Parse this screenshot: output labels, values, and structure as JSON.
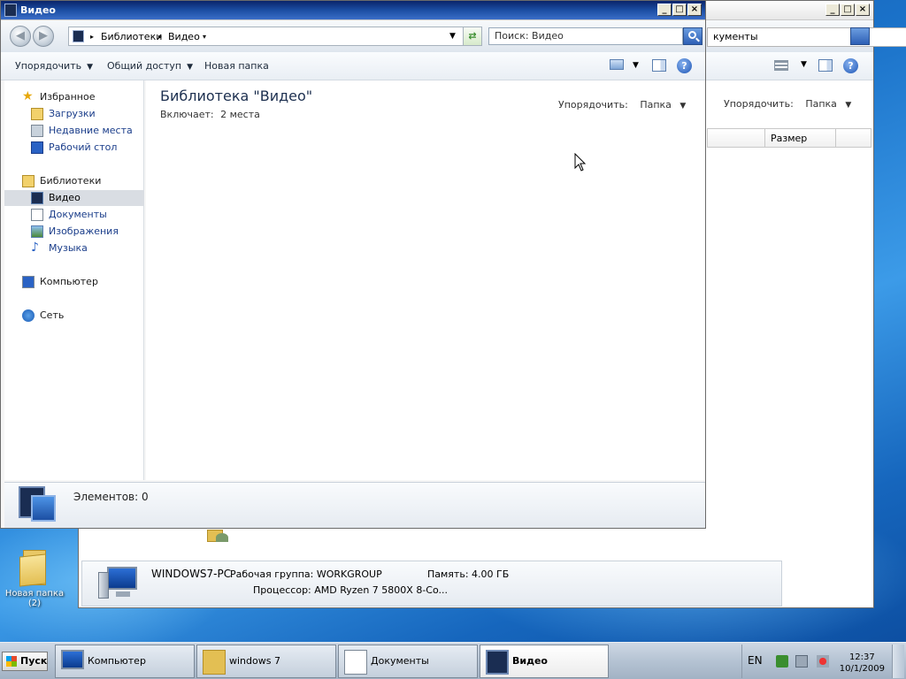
{
  "desktop": {
    "icon_label_line1": "Новая папка",
    "icon_label_line2": "(2)"
  },
  "back_window": {
    "search_text": "кументы",
    "arrange_label": "Упорядочить:",
    "arrange_value": "Папка",
    "column_header_size": "Размер",
    "details": {
      "computer_name": "WINDOWS7-PC",
      "workgroup": "Рабочая группа: WORKGROUP",
      "memory": "Память: 4.00 ГБ",
      "processor": "Процессор: AMD Ryzen 7 5800X 8-Co..."
    }
  },
  "window": {
    "title": "Видео",
    "address": {
      "segments": [
        "Библиотеки",
        "Видео"
      ]
    },
    "search_placeholder": "Поиск: Видео",
    "commands": {
      "organize": "Упорядочить",
      "share": "Общий доступ",
      "new_folder": "Новая папка"
    },
    "sidebar": {
      "favorites": "Избранное",
      "downloads": "Загрузки",
      "recent": "Недавние места",
      "desktop": "Рабочий стол",
      "libraries": "Библиотеки",
      "video": "Видео",
      "documents": "Документы",
      "images": "Изображения",
      "music": "Музыка",
      "computer": "Компьютер",
      "network": "Сеть"
    },
    "content": {
      "title": "Библиотека \"Видео\"",
      "includes_label": "Включает:",
      "includes_value": "2 места",
      "arrange_label": "Упорядочить:",
      "arrange_value": "Папка"
    },
    "status": "Элементов: 0"
  },
  "taskbar": {
    "start": "Пуск",
    "tasks": [
      "Компьютер",
      "windows 7",
      "Документы",
      "Видео"
    ],
    "lang": "EN",
    "time": "12:37",
    "date": "10/1/2009"
  },
  "colors": {
    "title_active": "#0a246a",
    "link": "#1a3d8a",
    "desktop": "#1b72c9"
  }
}
